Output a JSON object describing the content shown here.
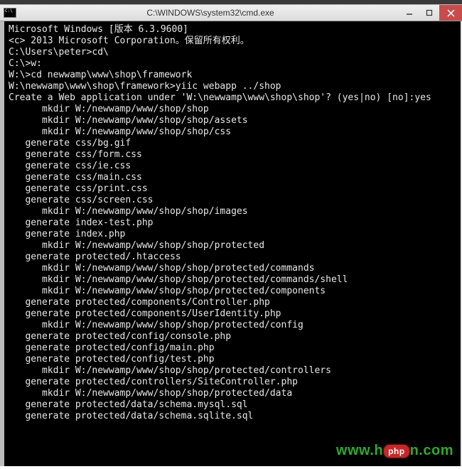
{
  "window": {
    "title": "C:\\WINDOWS\\system32\\cmd.exe",
    "minimize_label": "−",
    "maximize_label": "▢",
    "close_label": "×"
  },
  "terminal": {
    "lines": [
      "Microsoft Windows [版本 6.3.9600]",
      "<c> 2013 Microsoft Corporation。保留所有权利。",
      "",
      "C:\\Users\\peter>cd\\",
      "",
      "C:\\>w:",
      "",
      "W:\\>cd newwamp\\www\\shop\\framework",
      "",
      "W:\\newwamp\\www\\shop\\framework>yiic webapp ../shop",
      "Create a Web application under 'W:\\newwamp\\www\\shop\\shop'? (yes|no) [no]:yes",
      "      mkdir W:/newwamp/www/shop/shop",
      "      mkdir W:/newwamp/www/shop/shop/assets",
      "      mkdir W:/newwamp/www/shop/shop/css",
      "   generate css/bg.gif",
      "   generate css/form.css",
      "   generate css/ie.css",
      "   generate css/main.css",
      "   generate css/print.css",
      "   generate css/screen.css",
      "      mkdir W:/newwamp/www/shop/shop/images",
      "   generate index-test.php",
      "   generate index.php",
      "      mkdir W:/newwamp/www/shop/shop/protected",
      "   generate protected/.htaccess",
      "      mkdir W:/newwamp/www/shop/shop/protected/commands",
      "      mkdir W:/newwamp/www/shop/shop/protected/commands/shell",
      "      mkdir W:/newwamp/www/shop/shop/protected/components",
      "   generate protected/components/Controller.php",
      "   generate protected/components/UserIdentity.php",
      "      mkdir W:/newwamp/www/shop/shop/protected/config",
      "   generate protected/config/console.php",
      "   generate protected/config/main.php",
      "   generate protected/config/test.php",
      "      mkdir W:/newwamp/www/shop/shop/protected/controllers",
      "   generate protected/controllers/SiteController.php",
      "      mkdir W:/newwamp/www/shop/shop/protected/data",
      "   generate protected/data/schema.mysql.sql",
      "   generate protected/data/schema.sqlite.sql"
    ]
  },
  "watermark": {
    "prefix": "www.h",
    "pill": "php",
    "suffix": "n.com"
  }
}
